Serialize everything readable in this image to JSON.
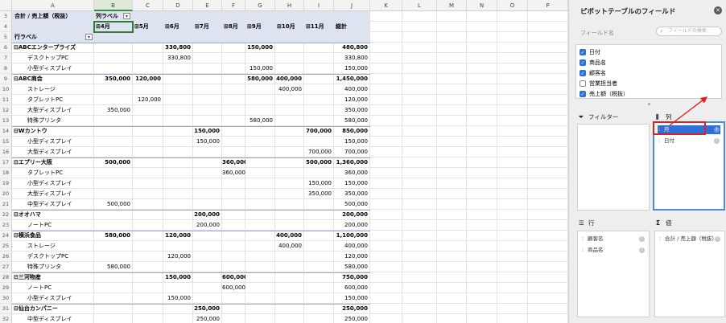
{
  "sheet": {
    "columns": [
      "A",
      "B",
      "C",
      "D",
      "E",
      "F",
      "G",
      "H",
      "I",
      "J",
      "K",
      "L",
      "M",
      "N",
      "O",
      "P"
    ],
    "selected_column": "B",
    "row_numbers": [
      "3",
      "4",
      "5",
      "6",
      "7",
      "8",
      "9",
      "10",
      "11",
      "12",
      "13",
      "14",
      "15",
      "16",
      "17",
      "18",
      "19",
      "20",
      "21",
      "22",
      "23",
      "24",
      "25",
      "26",
      "27",
      "28",
      "29",
      "30",
      "31",
      "32"
    ],
    "pivot": {
      "measure_label": "合計 / 売上額（税抜）",
      "column_labels_button": "列ラベル",
      "row_labels_button": "行ラベル",
      "months": [
        "4月",
        "5月",
        "6月",
        "7月",
        "8月",
        "9月",
        "10月",
        "11月"
      ],
      "total_label": "総計",
      "expand_glyph": "⊞",
      "collapse_glyph": "⊟",
      "dropdown_glyph": "▾",
      "rows": [
        {
          "label": "ABCエンタープライズ",
          "level": 0,
          "values": [
            "",
            "",
            "330,800",
            "",
            "",
            "150,000",
            "",
            "",
            "480,800"
          ]
        },
        {
          "label": "デスクトップPC",
          "level": 1,
          "values": [
            "",
            "",
            "330,800",
            "",
            "",
            "",
            "",
            "",
            "330,800"
          ]
        },
        {
          "label": "小型ディスプレイ",
          "level": 1,
          "values": [
            "",
            "",
            "",
            "",
            "",
            "150,000",
            "",
            "",
            "150,000"
          ]
        },
        {
          "label": "ABC商会",
          "level": 0,
          "values": [
            "350,000",
            "120,000",
            "",
            "",
            "",
            "580,000",
            "400,000",
            "",
            "1,450,000"
          ]
        },
        {
          "label": "ストレージ",
          "level": 1,
          "values": [
            "",
            "",
            "",
            "",
            "",
            "",
            "400,000",
            "",
            "400,000"
          ]
        },
        {
          "label": "タブレットPC",
          "level": 1,
          "values": [
            "",
            "120,000",
            "",
            "",
            "",
            "",
            "",
            "",
            "120,000"
          ]
        },
        {
          "label": "大型ディスプレイ",
          "level": 1,
          "values": [
            "350,000",
            "",
            "",
            "",
            "",
            "",
            "",
            "",
            "350,000"
          ]
        },
        {
          "label": "特殊プリンタ",
          "level": 1,
          "values": [
            "",
            "",
            "",
            "",
            "",
            "580,000",
            "",
            "",
            "580,000"
          ]
        },
        {
          "label": "Wカントウ",
          "level": 0,
          "values": [
            "",
            "",
            "",
            "150,000",
            "",
            "",
            "",
            "700,000",
            "850,000"
          ]
        },
        {
          "label": "小型ディスプレイ",
          "level": 1,
          "values": [
            "",
            "",
            "",
            "150,000",
            "",
            "",
            "",
            "",
            "150,000"
          ]
        },
        {
          "label": "大型ディスプレイ",
          "level": 1,
          "values": [
            "",
            "",
            "",
            "",
            "",
            "",
            "",
            "700,000",
            "700,000"
          ]
        },
        {
          "label": "エプリー大阪",
          "level": 0,
          "values": [
            "500,000",
            "",
            "",
            "",
            "360,000",
            "",
            "",
            "500,000",
            "1,360,000"
          ]
        },
        {
          "label": "タブレットPC",
          "level": 1,
          "values": [
            "",
            "",
            "",
            "",
            "360,000",
            "",
            "",
            "",
            "360,000"
          ]
        },
        {
          "label": "小型ディスプレイ",
          "level": 1,
          "values": [
            "",
            "",
            "",
            "",
            "",
            "",
            "",
            "150,000",
            "150,000"
          ]
        },
        {
          "label": "大型ディスプレイ",
          "level": 1,
          "values": [
            "",
            "",
            "",
            "",
            "",
            "",
            "",
            "350,000",
            "350,000"
          ]
        },
        {
          "label": "中型ディスプレイ",
          "level": 1,
          "values": [
            "500,000",
            "",
            "",
            "",
            "",
            "",
            "",
            "",
            "500,000"
          ]
        },
        {
          "label": "オオハマ",
          "level": 0,
          "values": [
            "",
            "",
            "",
            "200,000",
            "",
            "",
            "",
            "",
            "200,000"
          ]
        },
        {
          "label": "ノートPC",
          "level": 1,
          "values": [
            "",
            "",
            "",
            "200,000",
            "",
            "",
            "",
            "",
            "200,000"
          ]
        },
        {
          "label": "横浜食品",
          "level": 0,
          "values": [
            "580,000",
            "",
            "120,000",
            "",
            "",
            "",
            "400,000",
            "",
            "1,100,000"
          ]
        },
        {
          "label": "ストレージ",
          "level": 1,
          "values": [
            "",
            "",
            "",
            "",
            "",
            "",
            "400,000",
            "",
            "400,000"
          ]
        },
        {
          "label": "デスクトップPC",
          "level": 1,
          "values": [
            "",
            "",
            "120,000",
            "",
            "",
            "",
            "",
            "",
            "120,000"
          ]
        },
        {
          "label": "特殊プリンタ",
          "level": 1,
          "values": [
            "580,000",
            "",
            "",
            "",
            "",
            "",
            "",
            "",
            "580,000"
          ]
        },
        {
          "label": "三河物産",
          "level": 0,
          "values": [
            "",
            "",
            "150,000",
            "",
            "600,000",
            "",
            "",
            "",
            "750,000"
          ]
        },
        {
          "label": "ノートPC",
          "level": 1,
          "values": [
            "",
            "",
            "",
            "",
            "600,000",
            "",
            "",
            "",
            "600,000"
          ]
        },
        {
          "label": "小型ディスプレイ",
          "level": 1,
          "values": [
            "",
            "",
            "150,000",
            "",
            "",
            "",
            "",
            "",
            "150,000"
          ]
        },
        {
          "label": "仙台カンパニー",
          "level": 0,
          "values": [
            "",
            "",
            "",
            "250,000",
            "",
            "",
            "",
            "",
            "250,000"
          ]
        },
        {
          "label": "中型ディスプレイ",
          "level": 1,
          "values": [
            "",
            "",
            "",
            "250,000",
            "",
            "",
            "",
            "",
            "250,000"
          ]
        }
      ]
    }
  },
  "pane": {
    "title": "ピボットテーブルのフィールド",
    "close_glyph": "✕",
    "field_name_label": "フィールド名",
    "search_placeholder": "フィールドの検索",
    "search_glyph": "⌕",
    "fields": [
      {
        "label": "日付",
        "checked": true
      },
      {
        "label": "商品名",
        "checked": true
      },
      {
        "label": "顧客名",
        "checked": true
      },
      {
        "label": "営業担当者",
        "checked": false
      },
      {
        "label": "売上額（税抜）",
        "checked": true
      }
    ],
    "check_glyph": "✓",
    "filter_title": "フィルター",
    "filter_icon": "⏷",
    "columns_title": "列",
    "columns_icon": "⫼",
    "rows_title": "行",
    "rows_icon": "☰",
    "values_title": "値",
    "values_icon": "Σ",
    "grip_glyph": "⁝",
    "info_glyph": "i",
    "column_items": [
      "月",
      "日付"
    ],
    "row_items": [
      "顧客名",
      "商品名"
    ],
    "value_items": [
      "合計 / 売上額（税抜）"
    ],
    "annotation_color": "#e02020",
    "accent_color": "#2f6fd6"
  }
}
